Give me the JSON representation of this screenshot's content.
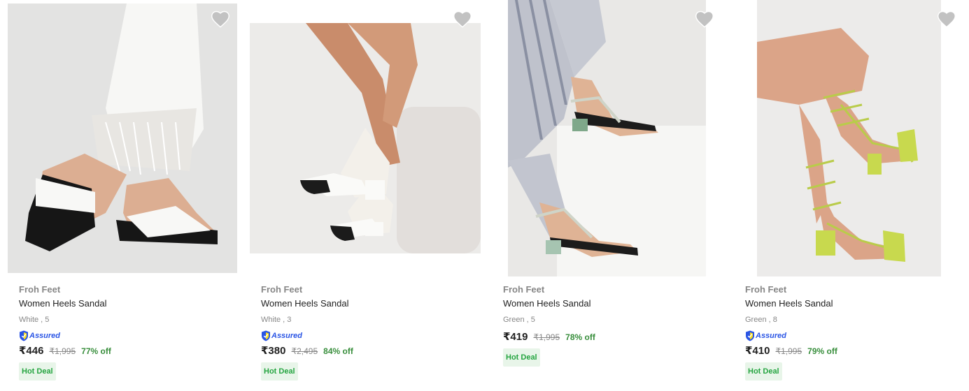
{
  "products": [
    {
      "brand": "Froh Feet",
      "title": "Women Heels Sandal",
      "variant": "White , 3",
      "assured": true,
      "assured_label": "Assured",
      "price": "₹380",
      "mrp": "₹2,495",
      "discount": "84% off",
      "deal": "Hot Deal",
      "image": "white-black-toe-heels-photo"
    },
    {
      "brand": "Froh Feet",
      "title": "Women Heels Sandal",
      "variant": "Green , 5",
      "assured": false,
      "price": "₹419",
      "mrp": "₹1,995",
      "discount": "78% off",
      "deal": "Hot Deal",
      "image": "strappy-block-heel-photo"
    },
    {
      "brand": "Froh Feet",
      "title": "Women Heels Sandal",
      "variant": "Green , 8",
      "assured": true,
      "assured_label": "Assured",
      "price": "₹410",
      "mrp": "₹1,995",
      "discount": "79% off",
      "deal": "Hot Deal",
      "image": "lime-lace-up-heel-photo"
    },
    {
      "brand": "Froh Feet",
      "title": "Women Heels Sandal",
      "variant": "White , 5",
      "assured": true,
      "assured_label": "Assured",
      "price": "₹446",
      "mrp": "₹1,995",
      "discount": "77% off",
      "deal": "Hot Deal",
      "image": "white-wedge-sandal-photo"
    }
  ],
  "colors": {
    "brand_text": "#878787",
    "discount": "#388e3c",
    "deal_bg": "#e8f5e9",
    "deal_text": "#26a541",
    "assured": "#2a55e5",
    "wishlist": "#c2c2c2"
  }
}
